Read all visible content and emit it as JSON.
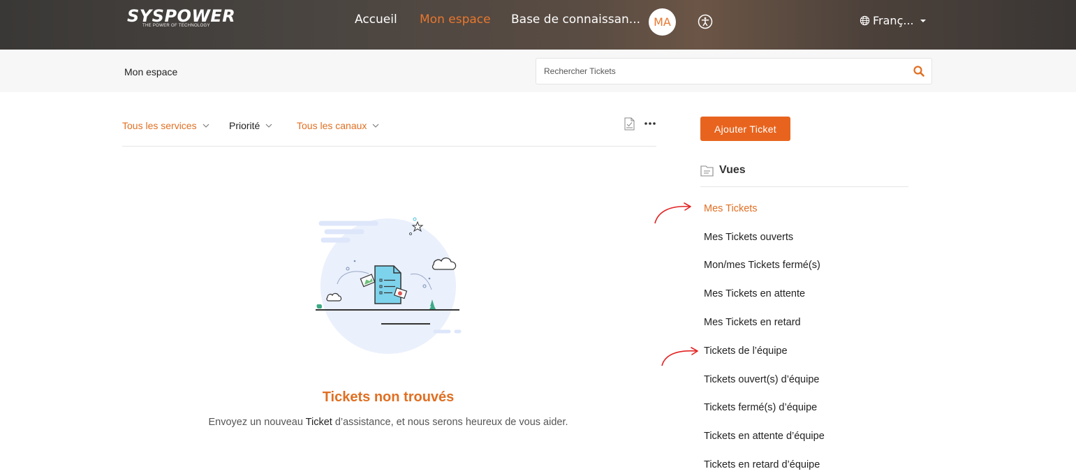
{
  "header": {
    "logo_main": "SYSPOWER",
    "logo_sub": "THE POWER OF TECHNOLOGY",
    "nav": [
      {
        "label": "Accueil",
        "active": false
      },
      {
        "label": "Mon espace",
        "active": true
      },
      {
        "label": "Base de connaissan..."
      }
    ],
    "avatar_initials": "MA",
    "language": "Franç..."
  },
  "subbar": {
    "breadcrumb": "Mon espace",
    "search_placeholder": "Rechercher Tickets"
  },
  "filters": [
    {
      "label": "Tous les services"
    },
    {
      "label": "Priorité"
    },
    {
      "label": "Tous les canaux"
    }
  ],
  "empty_state": {
    "title": "Tickets non trouvés",
    "desc_before": "Envoyez un nouveau ",
    "desc_highlight": "Ticket",
    "desc_after": " d’assistance, et nous serons heureux de vous aider."
  },
  "sidebar": {
    "add_button": "Ajouter Ticket",
    "views_title": "Vues",
    "views": [
      {
        "label": "Mes Tickets",
        "active": true
      },
      {
        "label": "Mes Tickets ouverts"
      },
      {
        "label": "Mon/mes Tickets fermé(s)"
      },
      {
        "label": "Mes Tickets en attente"
      },
      {
        "label": "Mes Tickets en retard"
      },
      {
        "label": "Tickets de l’équipe"
      },
      {
        "label": "Tickets ouvert(s) d’équipe"
      },
      {
        "label": "Tickets fermé(s) d’équipe"
      },
      {
        "label": "Tickets en attente d’équipe"
      },
      {
        "label": "Tickets en retard d’équipe"
      }
    ]
  },
  "colors": {
    "accent": "#e8641e",
    "annotation_arrow": "#e32222"
  }
}
